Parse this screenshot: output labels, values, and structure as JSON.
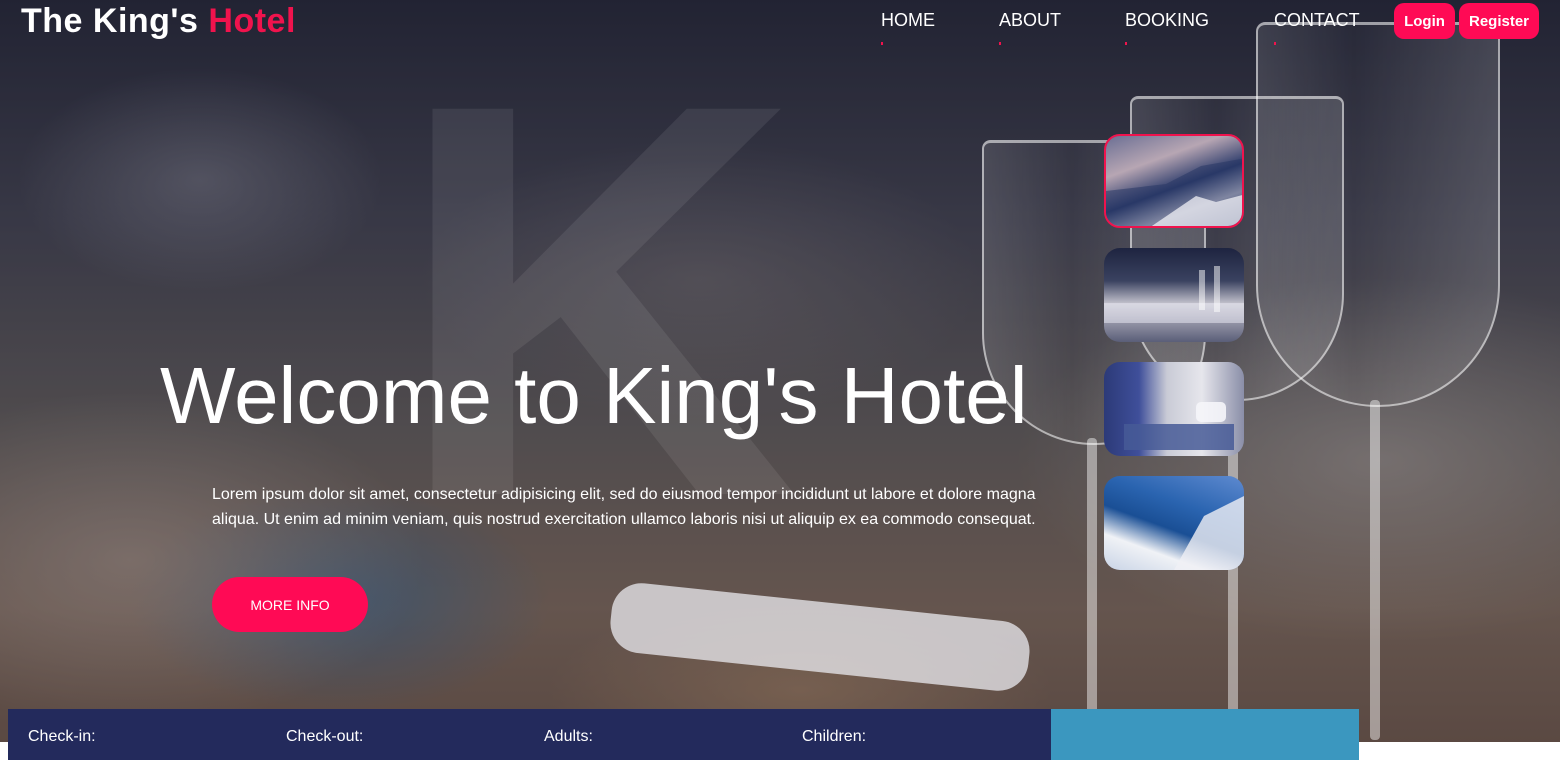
{
  "brand": {
    "name_part1": "The King's",
    "name_part2": "Hotel"
  },
  "nav": {
    "items": [
      {
        "label": "HOME"
      },
      {
        "label": "ABOUT"
      },
      {
        "label": "BOOKING"
      },
      {
        "label": "CONTACT"
      }
    ],
    "login_label": "Login",
    "register_label": "Register"
  },
  "hero": {
    "watermark": "K",
    "title": "Welcome to King's Hotel",
    "description": "Lorem ipsum dolor sit amet, consectetur adipisicing elit, sed do eiusmod tempor incididunt ut labore et dolore magna aliqua. Ut enim ad minim veniam, quis nostrud exercitation ullamco laboris nisi ut aliquip ex ea commodo consequat.",
    "more_info_label": "MORE INFO"
  },
  "thumbnails": [
    {
      "subject": "santorini-sunset",
      "active": true
    },
    {
      "subject": "restaurant-tables",
      "active": false
    },
    {
      "subject": "hotel-room",
      "active": false
    },
    {
      "subject": "santorini-coast",
      "active": false
    }
  ],
  "booking": {
    "checkin_label": "Check-in:",
    "checkout_label": "Check-out:",
    "adults_label": "Adults:",
    "children_label": "Children:"
  },
  "colors": {
    "accent": "#f0134d",
    "button": "#ff0a55",
    "booking_bar": "#232a5c",
    "booking_submit": "#3b97bf"
  }
}
